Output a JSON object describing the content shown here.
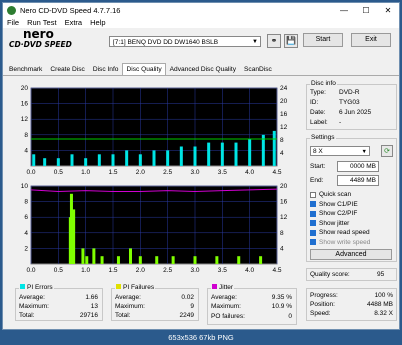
{
  "window": {
    "title": "Nero CD-DVD Speed 4.7.7.16",
    "minimize": "—",
    "maximize": "☐",
    "close": "✕"
  },
  "menu": [
    "File",
    "Run Test",
    "Extra",
    "Help"
  ],
  "logo": {
    "line1": "nero",
    "line2": "CD·DVD SPEED"
  },
  "toolbar": {
    "drive": "[7:1]  BENQ DVD DD DW1640 BSLB",
    "start": "Start",
    "exit": "Exit"
  },
  "tabs": [
    "Benchmark",
    "Create Disc",
    "Disc Info",
    "Disc Quality",
    "Advanced Disc Quality",
    "ScanDisc"
  ],
  "active_tab": "Disc Quality",
  "disc_info": {
    "legend": "Disc info",
    "type_label": "Type:",
    "type_value": "DVD-R",
    "id_label": "ID:",
    "id_value": "TYG03",
    "date_label": "Date:",
    "date_value": "6 Jun 2025",
    "label_label": "Label:",
    "label_value": "-"
  },
  "settings": {
    "legend": "Settings",
    "speed": "8 X",
    "start_label": "Start:",
    "start_value": "0000 MB",
    "end_label": "End:",
    "end_value": "4489 MB",
    "checkboxes": [
      {
        "label": "Quick scan",
        "checked": false,
        "enabled": true
      },
      {
        "label": "Show C1/PIE",
        "checked": true,
        "enabled": true
      },
      {
        "label": "Show C2/PIF",
        "checked": true,
        "enabled": true
      },
      {
        "label": "Show jitter",
        "checked": true,
        "enabled": true
      },
      {
        "label": "Show read speed",
        "checked": true,
        "enabled": true
      },
      {
        "label": "Show write speed",
        "checked": true,
        "enabled": false
      }
    ],
    "advanced": "Advanced"
  },
  "quality": {
    "label": "Quality score:",
    "value": "95"
  },
  "progress": {
    "progress_label": "Progress:",
    "progress_value": "100 %",
    "position_label": "Position:",
    "position_value": "4488 MB",
    "speed_label": "Speed:",
    "speed_value": "8.32 X"
  },
  "pi_errors": {
    "legend": "PI Errors",
    "color": "#00e5e5",
    "average_label": "Average:",
    "average": "1.66",
    "maximum_label": "Maximum:",
    "maximum": "13",
    "total_label": "Total:",
    "total": "29716"
  },
  "pi_failures": {
    "legend": "PI Failures",
    "color": "#e0e000",
    "average_label": "Average:",
    "average": "0.02",
    "maximum_label": "Maximum:",
    "maximum": "9",
    "total_label": "Total:",
    "total": "2249"
  },
  "jitter": {
    "legend": "Jitter",
    "color": "#d000d0",
    "average_label": "Average:",
    "average": "9.35 %",
    "maximum_label": "Maximum:",
    "maximum": "10.9 %",
    "po_label": "PO failures:",
    "po_value": "0"
  },
  "statusbar": "653x536 67kb PNG",
  "chart_data": [
    {
      "type": "bar",
      "title": "",
      "x_ticks": [
        "0.0",
        "0.5",
        "1.0",
        "1.5",
        "2.0",
        "2.5",
        "3.0",
        "3.5",
        "4.0",
        "4.5"
      ],
      "y_left_ticks": [
        "20",
        "16",
        "12",
        "8",
        "4"
      ],
      "y_right_ticks": [
        "24",
        "20",
        "16",
        "12",
        "8",
        "4"
      ],
      "xlim": [
        0,
        4.5
      ],
      "ylim": [
        0,
        20
      ],
      "y2lim": [
        0,
        24
      ],
      "series": [
        {
          "values_description_free": true,
          "x": [
            0.05,
            0.25,
            0.5,
            0.75,
            1.0,
            1.25,
            1.5,
            1.75,
            2.0,
            2.25,
            2.5,
            2.75,
            3.0,
            3.25,
            3.5,
            3.75,
            4.0,
            4.25,
            4.45
          ],
          "values": [
            3,
            2,
            2,
            3,
            2,
            3,
            3,
            4,
            3,
            4,
            4,
            5,
            5,
            6,
            6,
            6,
            7,
            8,
            9
          ]
        },
        {
          "x": [
            0.0,
            0.5,
            1.0,
            1.5,
            2.0,
            2.5,
            3.0,
            3.5,
            4.0,
            4.5
          ],
          "values": [
            8.3,
            8.3,
            8.3,
            8.3,
            8.3,
            8.3,
            8.3,
            8.3,
            8.3,
            8.3
          ]
        }
      ]
    },
    {
      "type": "bar",
      "title": "",
      "x_ticks": [
        "0.0",
        "0.5",
        "1.0",
        "1.5",
        "2.0",
        "2.5",
        "3.0",
        "3.5",
        "4.0",
        "4.5"
      ],
      "y_left_ticks": [
        "10",
        "8",
        "6",
        "4",
        "2"
      ],
      "y_right_ticks": [
        "20",
        "16",
        "12",
        "8",
        "4"
      ],
      "xlim": [
        0,
        4.5
      ],
      "ylim": [
        0,
        10
      ],
      "y2lim": [
        0,
        20
      ],
      "series": [
        {
          "x": [
            0.72,
            0.74,
            0.76,
            0.78,
            0.95,
            1.02,
            1.15,
            1.3,
            1.6,
            1.82,
            2.0,
            2.3,
            2.6,
            3.0,
            3.4,
            3.8,
            4.2
          ],
          "values": [
            6,
            9,
            5,
            7,
            2,
            1,
            2,
            1,
            1,
            2,
            1,
            1,
            1,
            1,
            1,
            1,
            1
          ]
        },
        {
          "x": [
            0.0,
            0.5,
            1.0,
            1.5,
            2.0,
            2.5,
            3.0,
            3.5,
            4.0,
            4.5
          ],
          "values": [
            9.5,
            9.3,
            9.4,
            9.3,
            9.3,
            9.4,
            9.3,
            9.4,
            9.5,
            9.6
          ]
        }
      ]
    }
  ]
}
